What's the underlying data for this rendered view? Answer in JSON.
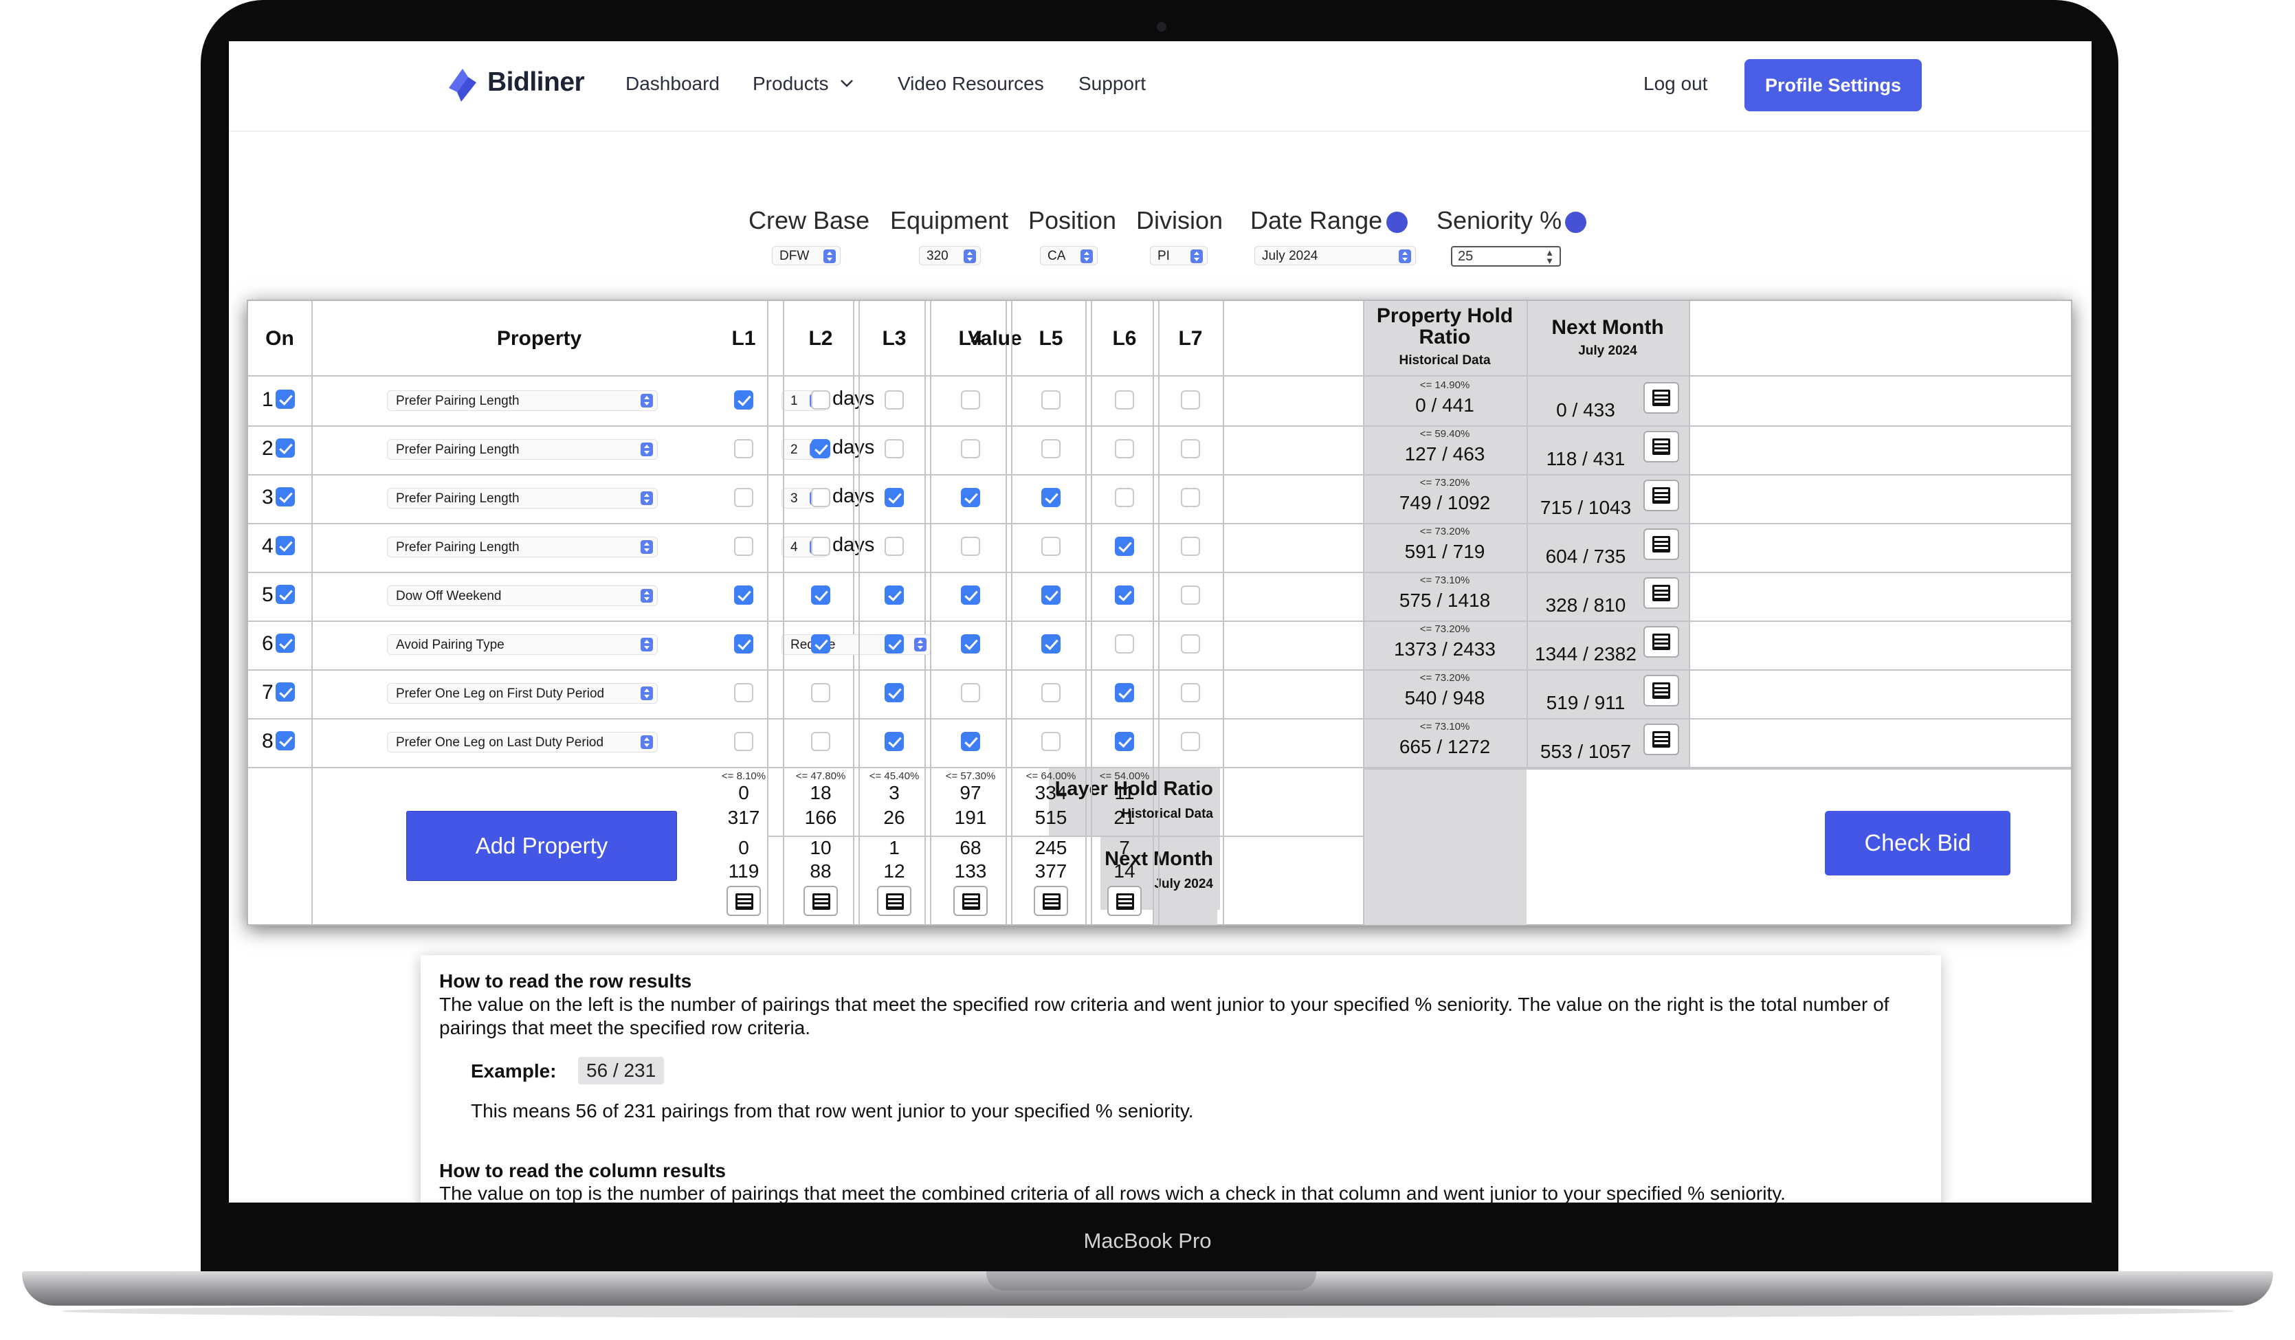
{
  "device": {
    "label": "MacBook Pro"
  },
  "nav": {
    "brand": "Bidliner",
    "links": [
      "Dashboard",
      "Products",
      "Video Resources",
      "Support"
    ],
    "logout": "Log out",
    "profile_button": "Profile Settings"
  },
  "filters": {
    "crew_base": {
      "label": "Crew Base",
      "value": "DFW"
    },
    "equipment": {
      "label": "Equipment",
      "value": "320"
    },
    "position": {
      "label": "Position",
      "value": "CA"
    },
    "division": {
      "label": "Division",
      "value": "PI"
    },
    "date_range": {
      "label": "Date Range",
      "value": "July 2024"
    },
    "seniority": {
      "label": "Seniority %",
      "value": "25"
    }
  },
  "table": {
    "headers": {
      "on": "On",
      "property": "Property",
      "value": "Value",
      "layers": [
        "L1",
        "L2",
        "L3",
        "L4",
        "L5",
        "L6",
        "L7"
      ],
      "phr_title": "Property Hold Ratio",
      "phr_sub": "Historical Data",
      "nm_title": "Next Month",
      "nm_sub": "July 2024"
    },
    "rows": [
      {
        "num": "1",
        "on": true,
        "property": "Prefer Pairing Length",
        "value": "1",
        "unit": "days",
        "layers": [
          true,
          false,
          false,
          false,
          false,
          false,
          false
        ],
        "phr_pct": "<= 14.90%",
        "phr": "0 / 441",
        "nm": "0 / 433"
      },
      {
        "num": "2",
        "on": true,
        "property": "Prefer Pairing Length",
        "value": "2",
        "unit": "days",
        "layers": [
          false,
          true,
          false,
          false,
          false,
          false,
          false
        ],
        "phr_pct": "<= 59.40%",
        "phr": "127 / 463",
        "nm": "118 / 431"
      },
      {
        "num": "3",
        "on": true,
        "property": "Prefer Pairing Length",
        "value": "3",
        "unit": "days",
        "layers": [
          false,
          false,
          true,
          true,
          true,
          false,
          false
        ],
        "phr_pct": "<= 73.20%",
        "phr": "749 / 1092",
        "nm": "715 / 1043"
      },
      {
        "num": "4",
        "on": true,
        "property": "Prefer Pairing Length",
        "value": "4",
        "unit": "days",
        "layers": [
          false,
          false,
          false,
          false,
          false,
          true,
          false
        ],
        "phr_pct": "<= 73.20%",
        "phr": "591 / 719",
        "nm": "604 / 735"
      },
      {
        "num": "5",
        "on": true,
        "property": "Dow Off Weekend",
        "value": "",
        "unit": "",
        "layers": [
          true,
          true,
          true,
          true,
          true,
          true,
          false
        ],
        "phr_pct": "<= 73.10%",
        "phr": "575 / 1418",
        "nm": "328 / 810"
      },
      {
        "num": "6",
        "on": true,
        "property": "Avoid Pairing Type",
        "value": "Redeye",
        "unit": "",
        "layers": [
          true,
          true,
          true,
          true,
          true,
          false,
          false
        ],
        "phr_pct": "<= 73.20%",
        "phr": "1373 / 2433",
        "nm": "1344 / 2382"
      },
      {
        "num": "7",
        "on": true,
        "property": "Prefer One Leg on First Duty Period",
        "value": "",
        "unit": "",
        "layers": [
          false,
          false,
          true,
          false,
          false,
          true,
          false
        ],
        "phr_pct": "<= 73.20%",
        "phr": "540 / 948",
        "nm": "519 / 911"
      },
      {
        "num": "8",
        "on": true,
        "property": "Prefer One Leg on Last Duty Period",
        "value": "",
        "unit": "",
        "layers": [
          false,
          false,
          true,
          true,
          false,
          true,
          false
        ],
        "phr_pct": "<= 73.10%",
        "phr": "665 / 1272",
        "nm": "553 / 1057"
      }
    ],
    "layer_hold": {
      "title": "Layer Hold Ratio",
      "sub": "Historical Data",
      "pct": [
        "<= 8.10%",
        "<= 47.80%",
        "<= 45.40%",
        "<= 57.30%",
        "<= 64.00%",
        "<= 54.00%"
      ],
      "top": [
        "0",
        "18",
        "3",
        "97",
        "334",
        "11"
      ],
      "bottom": [
        "317",
        "166",
        "26",
        "191",
        "515",
        "21"
      ]
    },
    "next_month": {
      "title": "Next Month",
      "sub": "July 2024",
      "top": [
        "0",
        "10",
        "1",
        "68",
        "245",
        "7"
      ],
      "bottom": [
        "119",
        "88",
        "12",
        "133",
        "377",
        "14"
      ]
    },
    "add_property": "Add Property",
    "check_bid": "Check Bid"
  },
  "help": {
    "row_title": "How to read the row results",
    "row_body": "The value on the left is the number of pairings that meet the specified row criteria and went junior to your specified % seniority. The value on the right is the total number of pairings that meet the specified row criteria.",
    "example_label": "Example:",
    "example_value": "56 / 231",
    "example_text": "This means 56 of 231 pairings from that row went junior to your specified % seniority.",
    "col_title": "How to read the column results",
    "col_body": "The value on top is the number of pairings that meet the combined criteria of all rows wich a check in that column and went junior to your specified % seniority."
  },
  "colors": {
    "accent": "#4b5ee6",
    "checkbox": "#3d7ef5",
    "info": "#4552d6"
  }
}
